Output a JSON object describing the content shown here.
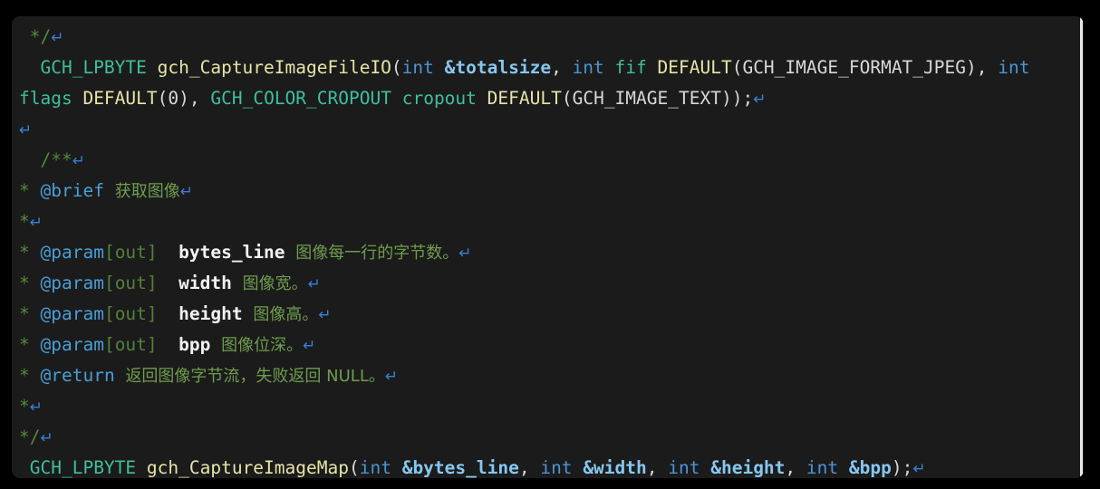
{
  "editor": {
    "background_color": "#1b1b1b",
    "page_background_color": "#000000",
    "scrollbar": {
      "name": "vertical-scrollbar",
      "thumb_color": "#e8e8e8",
      "track_color": "#2a2a2a"
    },
    "palette": {
      "comment": "#55893c",
      "chinese_text": "#6f9c4e",
      "pilcrow": "#3a7fd5",
      "type": "#3fbf9f",
      "function": "#e8e4a8",
      "keyword": "#4a95d6",
      "reference_param": "#86c7ef",
      "identifier": "#3fbf9f",
      "macro_argument": "#d8d8d8",
      "doxygen_tag": "#4a9ed6",
      "doxygen_direction": "#53803a",
      "param_name": "#f2f2f2"
    },
    "pilcrow_glyph": "↵",
    "lines": [
      {
        "id": "line-comment-close-1",
        "tokens": [
          {
            "text": " ",
            "type": "plain"
          },
          {
            "text": "*/",
            "type": "comment"
          },
          {
            "text": "↵",
            "type": "pilcrow"
          }
        ]
      },
      {
        "id": "line-capture-image-file-io-1",
        "tokens": [
          {
            "text": "  ",
            "type": "plain"
          },
          {
            "text": "GCH_LPBYTE",
            "type": "type"
          },
          {
            "text": " ",
            "type": "plain"
          },
          {
            "text": "gch_CaptureImageFileIO",
            "type": "function"
          },
          {
            "text": "(",
            "type": "plain"
          },
          {
            "text": "int",
            "type": "keyword"
          },
          {
            "text": " ",
            "type": "plain"
          },
          {
            "text": "&totalsize",
            "type": "reference_param"
          },
          {
            "text": ", ",
            "type": "plain"
          },
          {
            "text": "int",
            "type": "keyword"
          },
          {
            "text": " ",
            "type": "plain"
          },
          {
            "text": "fif",
            "type": "identifier"
          },
          {
            "text": " ",
            "type": "plain"
          },
          {
            "text": "DEFAULT",
            "type": "function"
          },
          {
            "text": "(",
            "type": "plain"
          },
          {
            "text": "GCH_IMAGE_FORMAT_JPEG",
            "type": "macro_argument"
          },
          {
            "text": "), ",
            "type": "plain"
          },
          {
            "text": "int",
            "type": "keyword"
          }
        ]
      },
      {
        "id": "line-capture-image-file-io-2",
        "tokens": [
          {
            "text": "flags",
            "type": "identifier"
          },
          {
            "text": " ",
            "type": "plain"
          },
          {
            "text": "DEFAULT",
            "type": "function"
          },
          {
            "text": "(",
            "type": "plain"
          },
          {
            "text": "0",
            "type": "macro_argument"
          },
          {
            "text": "), ",
            "type": "plain"
          },
          {
            "text": "GCH_COLOR_CROPOUT",
            "type": "type"
          },
          {
            "text": " ",
            "type": "plain"
          },
          {
            "text": "cropout",
            "type": "identifier"
          },
          {
            "text": " ",
            "type": "plain"
          },
          {
            "text": "DEFAULT",
            "type": "function"
          },
          {
            "text": "(",
            "type": "plain"
          },
          {
            "text": "GCH_IMAGE_TEXT",
            "type": "macro_argument"
          },
          {
            "text": "));",
            "type": "plain"
          },
          {
            "text": "↵",
            "type": "pilcrow"
          }
        ]
      },
      {
        "id": "line-blank-1",
        "tokens": [
          {
            "text": "↵",
            "type": "pilcrow"
          }
        ]
      },
      {
        "id": "line-doc-open",
        "tokens": [
          {
            "text": "  ",
            "type": "plain"
          },
          {
            "text": "/**",
            "type": "comment"
          },
          {
            "text": "↵",
            "type": "pilcrow"
          }
        ]
      },
      {
        "id": "line-doc-brief",
        "tokens": [
          {
            "text": "*",
            "type": "comment"
          },
          {
            "text": " ",
            "type": "plain"
          },
          {
            "text": "@brief",
            "type": "doxygen_tag"
          },
          {
            "text": " ",
            "type": "plain"
          },
          {
            "text": "获取图像",
            "type": "chinese"
          },
          {
            "text": "↵",
            "type": "pilcrow"
          }
        ]
      },
      {
        "id": "line-doc-sep-1",
        "tokens": [
          {
            "text": "*",
            "type": "comment"
          },
          {
            "text": "↵",
            "type": "pilcrow"
          }
        ]
      },
      {
        "id": "line-doc-param-bytes-line",
        "tokens": [
          {
            "text": "*",
            "type": "comment"
          },
          {
            "text": " ",
            "type": "plain"
          },
          {
            "text": "@param",
            "type": "doxygen_tag"
          },
          {
            "text": "[out]",
            "type": "doxygen_direction"
          },
          {
            "text": "  ",
            "type": "plain"
          },
          {
            "text": "bytes_line",
            "type": "param_name"
          },
          {
            "text": " ",
            "type": "plain"
          },
          {
            "text": "图像每一行的字节数。",
            "type": "chinese"
          },
          {
            "text": "↵",
            "type": "pilcrow"
          }
        ]
      },
      {
        "id": "line-doc-param-width",
        "tokens": [
          {
            "text": "*",
            "type": "comment"
          },
          {
            "text": " ",
            "type": "plain"
          },
          {
            "text": "@param",
            "type": "doxygen_tag"
          },
          {
            "text": "[out]",
            "type": "doxygen_direction"
          },
          {
            "text": "  ",
            "type": "plain"
          },
          {
            "text": "width",
            "type": "param_name"
          },
          {
            "text": " ",
            "type": "plain"
          },
          {
            "text": "图像宽。",
            "type": "chinese"
          },
          {
            "text": "↵",
            "type": "pilcrow"
          }
        ]
      },
      {
        "id": "line-doc-param-height",
        "tokens": [
          {
            "text": "*",
            "type": "comment"
          },
          {
            "text": " ",
            "type": "plain"
          },
          {
            "text": "@param",
            "type": "doxygen_tag"
          },
          {
            "text": "[out]",
            "type": "doxygen_direction"
          },
          {
            "text": "  ",
            "type": "plain"
          },
          {
            "text": "height",
            "type": "param_name"
          },
          {
            "text": " ",
            "type": "plain"
          },
          {
            "text": "图像高。",
            "type": "chinese"
          },
          {
            "text": "↵",
            "type": "pilcrow"
          }
        ]
      },
      {
        "id": "line-doc-param-bpp",
        "tokens": [
          {
            "text": "*",
            "type": "comment"
          },
          {
            "text": " ",
            "type": "plain"
          },
          {
            "text": "@param",
            "type": "doxygen_tag"
          },
          {
            "text": "[out]",
            "type": "doxygen_direction"
          },
          {
            "text": "  ",
            "type": "plain"
          },
          {
            "text": "bpp",
            "type": "param_name"
          },
          {
            "text": " ",
            "type": "plain"
          },
          {
            "text": "图像位深。",
            "type": "chinese"
          },
          {
            "text": "↵",
            "type": "pilcrow"
          }
        ]
      },
      {
        "id": "line-doc-return",
        "tokens": [
          {
            "text": "*",
            "type": "comment"
          },
          {
            "text": " ",
            "type": "plain"
          },
          {
            "text": "@return",
            "type": "doxygen_tag"
          },
          {
            "text": " ",
            "type": "plain"
          },
          {
            "text": "返回图像字节流，失败返回 NULL。",
            "type": "chinese"
          },
          {
            "text": "↵",
            "type": "pilcrow"
          }
        ]
      },
      {
        "id": "line-doc-sep-2",
        "tokens": [
          {
            "text": "*",
            "type": "comment"
          },
          {
            "text": "↵",
            "type": "pilcrow"
          }
        ]
      },
      {
        "id": "line-doc-close",
        "tokens": [
          {
            "text": "*/",
            "type": "comment"
          },
          {
            "text": "↵",
            "type": "pilcrow"
          }
        ]
      },
      {
        "id": "line-capture-image-map",
        "tokens": [
          {
            "text": " ",
            "type": "plain"
          },
          {
            "text": "GCH_LPBYTE",
            "type": "type"
          },
          {
            "text": " ",
            "type": "plain"
          },
          {
            "text": "gch_CaptureImageMap",
            "type": "function"
          },
          {
            "text": "(",
            "type": "plain"
          },
          {
            "text": "int",
            "type": "keyword"
          },
          {
            "text": " ",
            "type": "plain"
          },
          {
            "text": "&bytes_line",
            "type": "reference_param"
          },
          {
            "text": ", ",
            "type": "plain"
          },
          {
            "text": "int",
            "type": "keyword"
          },
          {
            "text": " ",
            "type": "plain"
          },
          {
            "text": "&width",
            "type": "reference_param"
          },
          {
            "text": ", ",
            "type": "plain"
          },
          {
            "text": "int",
            "type": "keyword"
          },
          {
            "text": " ",
            "type": "plain"
          },
          {
            "text": "&height",
            "type": "reference_param"
          },
          {
            "text": ", ",
            "type": "plain"
          },
          {
            "text": "int",
            "type": "keyword"
          },
          {
            "text": " ",
            "type": "plain"
          },
          {
            "text": "&bpp",
            "type": "reference_param"
          },
          {
            "text": ");",
            "type": "plain"
          },
          {
            "text": "↵",
            "type": "pilcrow"
          }
        ]
      }
    ]
  }
}
